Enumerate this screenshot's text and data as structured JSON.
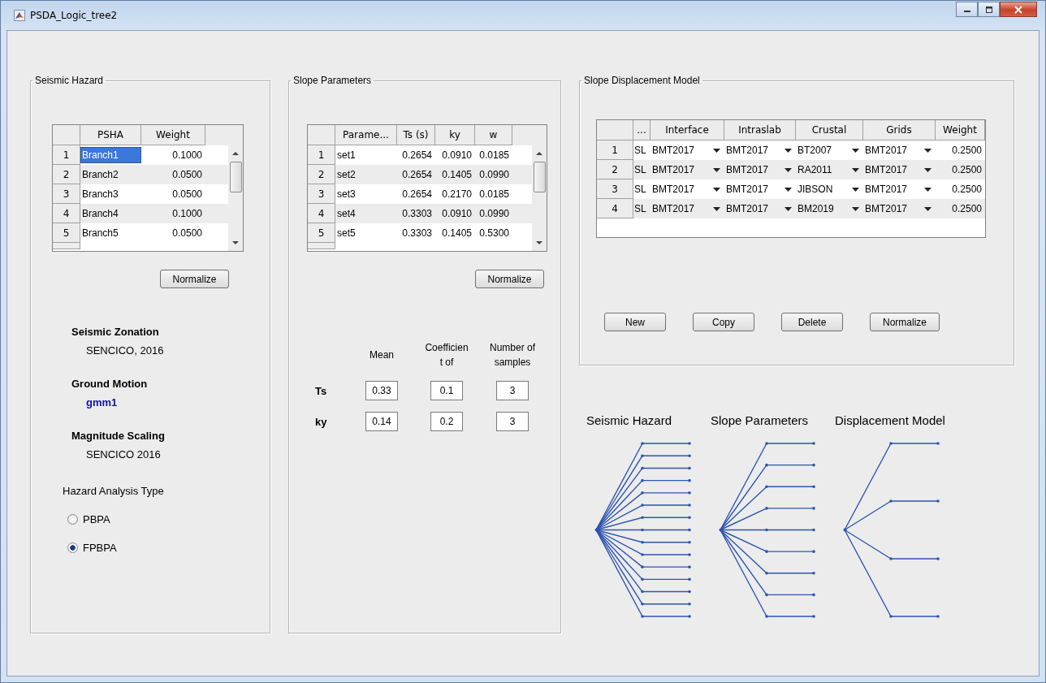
{
  "window": {
    "title": "PSDA_Logic_tree2"
  },
  "seismic_hazard": {
    "title": "Seismic Hazard",
    "table": {
      "columns": [
        "PSHA",
        "Weight"
      ],
      "rows": [
        {
          "index": "1",
          "name": "Branch1",
          "weight": "0.1000",
          "selected": true
        },
        {
          "index": "2",
          "name": "Branch2",
          "weight": "0.0500",
          "selected": false
        },
        {
          "index": "3",
          "name": "Branch3",
          "weight": "0.0500",
          "selected": false
        },
        {
          "index": "4",
          "name": "Branch4",
          "weight": "0.1000",
          "selected": false
        },
        {
          "index": "5",
          "name": "Branch5",
          "weight": "0.0500",
          "selected": false
        }
      ]
    },
    "normalize_button": "Normalize",
    "sections": [
      {
        "heading": "Seismic Zonation",
        "value": "SENCICO, 2016",
        "kind": "plain"
      },
      {
        "heading": "Ground Motion",
        "value": "gmm1",
        "kind": "highlight"
      },
      {
        "heading": "Magnitude Scaling",
        "value": "SENCICO 2016",
        "kind": "plain"
      }
    ],
    "analysis_type": {
      "label": "Hazard Analysis Type",
      "options": [
        {
          "label": "PBPA",
          "selected": false
        },
        {
          "label": "FPBPA",
          "selected": true
        }
      ]
    }
  },
  "slope_parameters": {
    "title": "Slope Parameters",
    "table": {
      "columns": [
        "Parame...",
        "Ts (s)",
        "ky",
        "w"
      ],
      "rows": [
        {
          "index": "1",
          "cells": [
            "set1",
            "0.2654",
            "0.0910",
            "0.0185"
          ]
        },
        {
          "index": "2",
          "cells": [
            "set2",
            "0.2654",
            "0.1405",
            "0.0990"
          ]
        },
        {
          "index": "3",
          "cells": [
            "set3",
            "0.2654",
            "0.2170",
            "0.0185"
          ]
        },
        {
          "index": "4",
          "cells": [
            "set4",
            "0.3303",
            "0.0910",
            "0.0990"
          ]
        },
        {
          "index": "5",
          "cells": [
            "set5",
            "0.3303",
            "0.1405",
            "0.5300"
          ]
        }
      ]
    },
    "normalize_button": "Normalize",
    "sampling": {
      "columns": [
        {
          "lines": [
            "Mean"
          ]
        },
        {
          "lines": [
            "Coefficien",
            "t of"
          ]
        },
        {
          "lines": [
            "Number of",
            "samples"
          ]
        }
      ],
      "rows": [
        {
          "label": "Ts",
          "values": [
            "0.33",
            "0.1",
            "3"
          ]
        },
        {
          "label": "ky",
          "values": [
            "0.14",
            "0.2",
            "3"
          ]
        }
      ]
    }
  },
  "displacement_model": {
    "title": "Slope Displacement Model",
    "table": {
      "columns": [
        {
          "label": "...",
          "kind": "text"
        },
        {
          "label": "Interface",
          "kind": "dropdown"
        },
        {
          "label": "Intraslab",
          "kind": "dropdown"
        },
        {
          "label": "Crustal",
          "kind": "dropdown"
        },
        {
          "label": "Grids",
          "kind": "dropdown"
        },
        {
          "label": "Weight",
          "kind": "number"
        }
      ],
      "rows": [
        {
          "index": "1",
          "cells": [
            "SL",
            "BMT2017",
            "BMT2017",
            "BT2007",
            "BMT2017",
            "0.2500"
          ]
        },
        {
          "index": "2",
          "cells": [
            "SL",
            "BMT2017",
            "BMT2017",
            "RA2011",
            "BMT2017",
            "0.2500"
          ]
        },
        {
          "index": "3",
          "cells": [
            "SL",
            "BMT2017",
            "BMT2017",
            "JIBSON",
            "BMT2017",
            "0.2500"
          ]
        },
        {
          "index": "4",
          "cells": [
            "SL",
            "BMT2017",
            "BMT2017",
            "BM2019",
            "BMT2017",
            "0.2500"
          ]
        }
      ]
    },
    "buttons": [
      "New",
      "Copy",
      "Delete",
      "Normalize"
    ]
  },
  "logic_tree": {
    "titles": [
      "Seismic Hazard",
      "Slope Parameters",
      "Displacement Model"
    ]
  }
}
